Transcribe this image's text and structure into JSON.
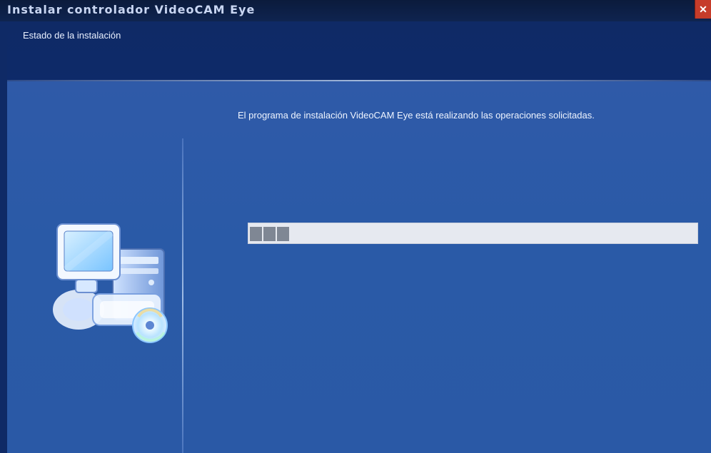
{
  "window": {
    "title": "Instalar controlador VideoCAM Eye",
    "close_label": "✕"
  },
  "header": {
    "subtitle": "Estado de la instalación"
  },
  "content": {
    "status_text": "El programa de instalación VideoCAM Eye está realizando las operaciones solicitadas.",
    "progress": {
      "value_percent": 9,
      "filled_chunks": 3
    }
  },
  "icons": {
    "setup": "computer-setup-icon",
    "close": "close-icon"
  },
  "colors": {
    "titlebar": "#0b1b3c",
    "header": "#0f2a66",
    "content": "#2f5aa8",
    "progress_track": "#e6e9f0",
    "progress_chunk": "#7f8794"
  }
}
